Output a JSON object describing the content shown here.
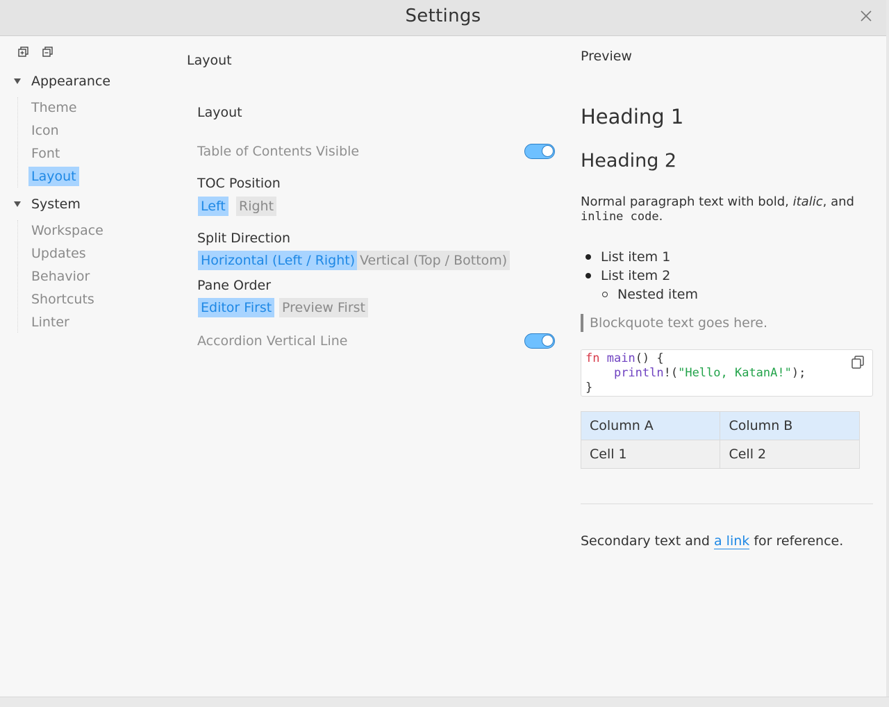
{
  "window": {
    "title": "Settings"
  },
  "sidebar": {
    "groups": [
      {
        "label": "Appearance",
        "items": [
          "Theme",
          "Icon",
          "Font",
          "Layout"
        ]
      },
      {
        "label": "System",
        "items": [
          "Workspace",
          "Updates",
          "Behavior",
          "Shortcuts",
          "Linter"
        ]
      }
    ],
    "active_item": "Layout"
  },
  "layout_panel": {
    "title": "Layout",
    "section": "Layout",
    "toc_visible": {
      "label": "Table of Contents Visible",
      "enabled": true
    },
    "toc_position": {
      "label": "TOC Position",
      "options": [
        "Left",
        "Right"
      ],
      "selected": "Left"
    },
    "split_direction": {
      "label": "Split Direction",
      "options": [
        "Horizontal (Left / Right)",
        "Vertical (Top / Bottom)"
      ],
      "selected": "Horizontal (Left / Right)"
    },
    "pane_order": {
      "label": "Pane Order",
      "options": [
        "Editor First",
        "Preview First"
      ],
      "selected": "Editor First"
    },
    "accordion_line": {
      "label": "Accordion Vertical Line",
      "enabled": true
    }
  },
  "preview": {
    "title": "Preview",
    "heading1": "Heading 1",
    "heading2": "Heading 2",
    "para_start": "Normal paragraph text with bold, ",
    "para_italic": "italic",
    "para_mid": ", and ",
    "para_code": "inline code",
    "para_end": ".",
    "list_item_1": "List item 1",
    "list_item_2": "List item 2",
    "nested_item": "Nested item",
    "blockquote": "Blockquote text goes here.",
    "code": {
      "l1_kw": "fn",
      "l1_fn": "main",
      "l1_rest": "() {",
      "l2_indent": "    ",
      "l2_fn": "println",
      "l2_a": "!(",
      "l2_str": "\"Hello, KatanA!\"",
      "l2_b": ");",
      "l3": "}"
    },
    "table": {
      "headers": [
        "Column A",
        "Column B"
      ],
      "rows": [
        [
          "Cell 1",
          "Cell 2"
        ]
      ]
    },
    "secondary_start": "Secondary text and ",
    "secondary_link": "a link",
    "secondary_end": " for reference."
  }
}
